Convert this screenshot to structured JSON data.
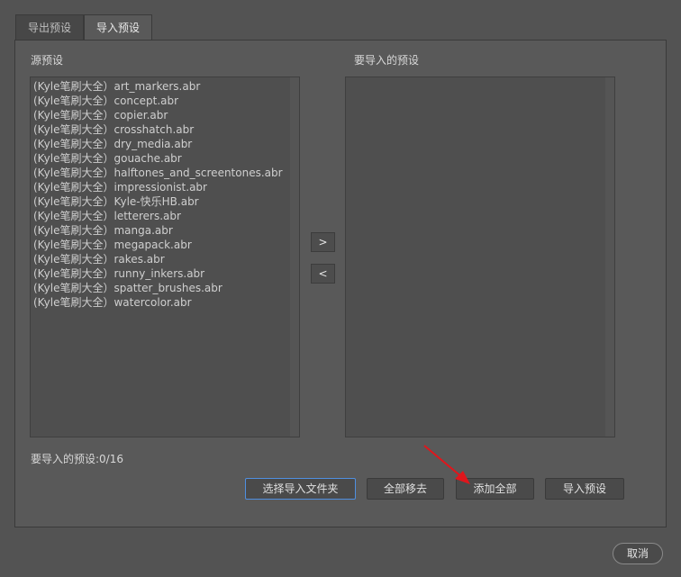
{
  "tabs": [
    {
      "label": "导出预设",
      "active": false
    },
    {
      "label": "导入预设",
      "active": true
    }
  ],
  "source": {
    "label": "源预设",
    "items": [
      "(Kyle笔刷大全）art_markers.abr",
      "(Kyle笔刷大全）concept.abr",
      "(Kyle笔刷大全）copier.abr",
      "(Kyle笔刷大全）crosshatch.abr",
      "(Kyle笔刷大全）dry_media.abr",
      "(Kyle笔刷大全）gouache.abr",
      "(Kyle笔刷大全）halftones_and_screentones.abr",
      "(Kyle笔刷大全）impressionist.abr",
      "(Kyle笔刷大全）Kyle-快乐HB.abr",
      "(Kyle笔刷大全）letterers.abr",
      "(Kyle笔刷大全）manga.abr",
      "(Kyle笔刷大全）megapack.abr",
      "(Kyle笔刷大全）rakes.abr",
      "(Kyle笔刷大全）runny_inkers.abr",
      "(Kyle笔刷大全）spatter_brushes.abr",
      "(Kyle笔刷大全）watercolor.abr"
    ]
  },
  "target": {
    "label": "要导入的预设"
  },
  "move": {
    "add_label": ">",
    "remove_label": "<"
  },
  "status": "要导入的预设:0/16",
  "buttons": {
    "choose_folder": "选择导入文件夹",
    "remove_all": "全部移去",
    "add_all": "添加全部",
    "import": "导入预设",
    "cancel": "取消"
  },
  "colors": {
    "background": "#535353",
    "panel": "#595959",
    "focus_border": "#4f8fe0",
    "annotation_arrow": "#e0161c"
  }
}
